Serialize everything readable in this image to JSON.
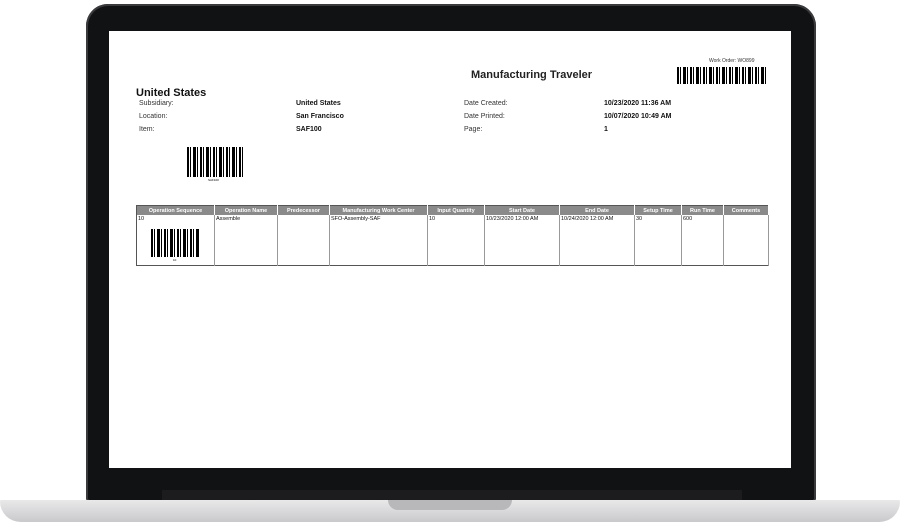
{
  "document": {
    "title": "Manufacturing Traveler",
    "work_order_label": "Work Order: WO899",
    "company": "United States",
    "item_barcode_caption": "SAF100",
    "fields_left": [
      {
        "label": "Subsidiary:",
        "value": "United States"
      },
      {
        "label": "Location:",
        "value": "San Francisco"
      },
      {
        "label": "Item:",
        "value": "SAF100"
      }
    ],
    "fields_right": [
      {
        "label": "Date Created:",
        "value": "10/23/2020 11:36 AM"
      },
      {
        "label": "Date Printed:",
        "value": "10/07/2020 10:49 AM"
      },
      {
        "label": "Page:",
        "value": "1"
      }
    ]
  },
  "operations": {
    "columns": [
      "Operation Sequence",
      "Operation Name",
      "Predecessor",
      "Manufacturing Work Center",
      "Input Quantity",
      "Start Date",
      "End Date",
      "Setup Time",
      "Run Time",
      "Comments"
    ],
    "rows": [
      {
        "sequence": "10",
        "name": "Assemble",
        "predecessor": "",
        "work_center": "SFO-Assembly-SAF",
        "input_quantity": "10",
        "start_date": "10/23/2020 12:00 AM",
        "end_date": "10/24/2020 12:00 AM",
        "setup_time": "30",
        "run_time": "600",
        "comments": "",
        "barcode_caption": "10"
      }
    ]
  }
}
